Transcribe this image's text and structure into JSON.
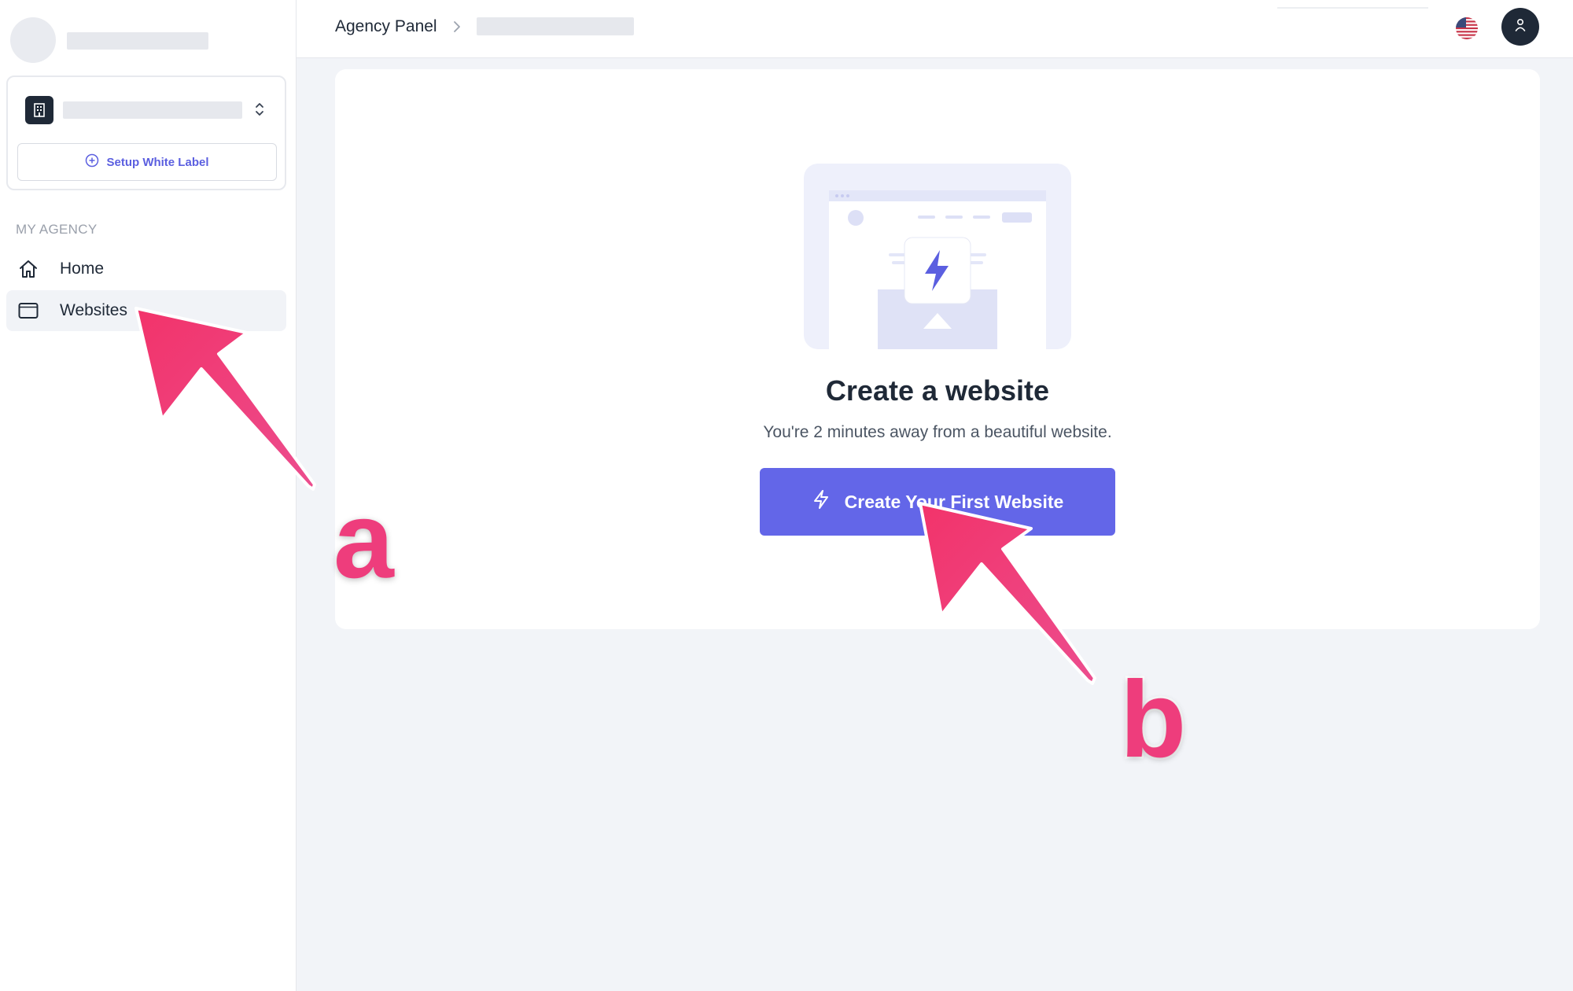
{
  "sidebar": {
    "white_label_button": "Setup White Label",
    "section_label": "MY AGENCY",
    "nav": [
      {
        "label": "Home",
        "icon": "home-icon"
      },
      {
        "label": "Websites",
        "icon": "browser-window-icon",
        "active": true
      }
    ]
  },
  "topbar": {
    "breadcrumb_root": "Agency Panel",
    "language_icon": "us-flag-icon",
    "user_icon": "user-icon"
  },
  "main": {
    "empty_state": {
      "title": "Create a website",
      "subtitle": "You're 2 minutes away from a beautiful website.",
      "cta_label": "Create Your First Website",
      "cta_icon": "lightning-icon"
    }
  },
  "annotations": {
    "marker_a": "a",
    "marker_b": "b"
  },
  "colors": {
    "accent": "#6366e8",
    "annotation": "#ee3d7c",
    "background": "#f2f4f8"
  }
}
